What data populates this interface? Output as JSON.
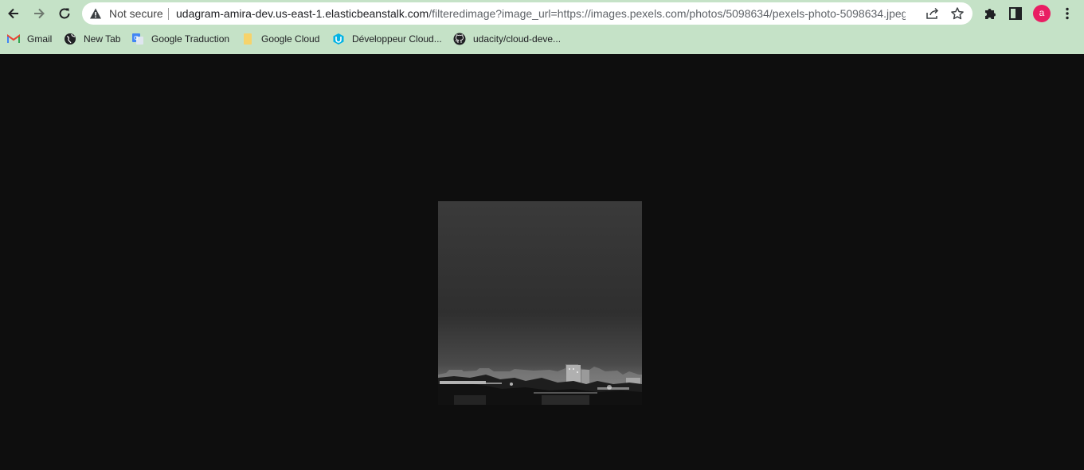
{
  "browser": {
    "security_label": "Not secure",
    "url_host": "udagram-amira-dev.us-east-1.elasticbeanstalk.com",
    "url_rest": "/filteredimage?image_url=https://images.pexels.com/photos/5098634/pexels-photo-5098634.jpeg...",
    "avatar_letter": "a",
    "toolbar_color": "#c5e2c7",
    "avatar_color": "#e91e63"
  },
  "bookmarks": [
    {
      "label": "Gmail",
      "icon": "gmail-icon"
    },
    {
      "label": "New Tab",
      "icon": "globe-icon"
    },
    {
      "label": "Google Traduction",
      "icon": "google-translate-icon"
    },
    {
      "label": "Google Cloud",
      "icon": "folder-icon"
    },
    {
      "label": "Développeur Cloud...",
      "icon": "udacity-icon"
    },
    {
      "label": "udacity/cloud-deve...",
      "icon": "github-icon"
    }
  ],
  "page": {
    "background": "#0e0e0e",
    "image_description_icon": "grayscale-city-skyline-image"
  }
}
